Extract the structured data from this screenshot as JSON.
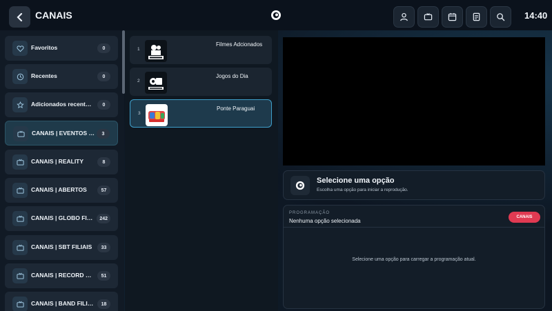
{
  "topbar": {
    "back_icon": "chevron-left-icon",
    "title": "CANAIS",
    "logo_icon": "app-logo-icon",
    "icons": [
      "user-icon",
      "tv-icon",
      "calendar-icon",
      "document-icon",
      "search-icon"
    ],
    "clock": "14:40"
  },
  "sidebar": {
    "items": [
      {
        "label": "Favoritos",
        "count": "0",
        "icon": "heart-icon"
      },
      {
        "label": "Recentes",
        "count": "0",
        "icon": "clock-icon"
      },
      {
        "label": "Adicionados recentem…",
        "count": "0",
        "icon": "star-icon"
      },
      {
        "label": "CANAIS | EVENTOS E …",
        "count": "3",
        "icon": "tv-icon",
        "active": true
      },
      {
        "label": "CANAIS | REALITY",
        "count": "8",
        "icon": "tv-icon"
      },
      {
        "label": "CANAIS | ABERTOS",
        "count": "57",
        "icon": "tv-icon"
      },
      {
        "label": "CANAIS | GLOBO FILIAIS",
        "count": "242",
        "icon": "tv-icon"
      },
      {
        "label": "CANAIS | SBT FILIAIS",
        "count": "33",
        "icon": "tv-icon"
      },
      {
        "label": "CANAIS | RECORD FILI…",
        "count": "51",
        "icon": "tv-icon"
      },
      {
        "label": "CANAIS | BAND FILIAIS",
        "count": "18",
        "icon": "tv-icon"
      }
    ]
  },
  "channels": [
    {
      "num": "1",
      "name": "Filmes Adcionados",
      "logo": "filmes-logo-icon"
    },
    {
      "num": "2",
      "name": "Jogos do Dia",
      "logo": "jogos-do-dia-logo-icon"
    },
    {
      "num": "3",
      "name": "Ponte Paraguai",
      "logo": "ponte-paraguai-logo-icon",
      "active": true
    }
  ],
  "player": {
    "select_title": "Selecione uma opção",
    "select_sub": "Escolha uma opção para iniciar a reprodução."
  },
  "programacao": {
    "label": "PROGRAMAÇÃO",
    "status": "Nenhuma opção selecionada",
    "pill": "CANAIS",
    "empty": "Selecione uma opção para carregar a programação atual."
  },
  "colors": {
    "accent": "#3fa0cc",
    "pill": "#e03a52",
    "background": "#0d1622"
  }
}
